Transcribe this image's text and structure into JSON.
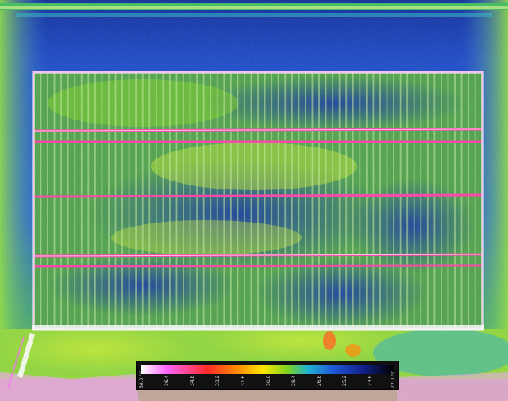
{
  "image": {
    "kind": "thermal aerial photograph of a field trial",
    "palette": {
      "hot": "#ffffff",
      "magenta": "#ff66ff",
      "red": "#ff2a2a",
      "orange": "#ff8a00",
      "yellow": "#ffe600",
      "green": "#7ed321",
      "cyan": "#1fb2d0",
      "blue": "#2058d8",
      "navy": "#10208a",
      "cold": "#000000"
    }
  },
  "scale_bar": {
    "ticks": [
      "38.0 °C",
      "36.4",
      "34.8",
      "33.2",
      "31.6",
      "30.0",
      "28.4",
      "26.8",
      "25.2",
      "23.6",
      "22.0 °C"
    ]
  }
}
